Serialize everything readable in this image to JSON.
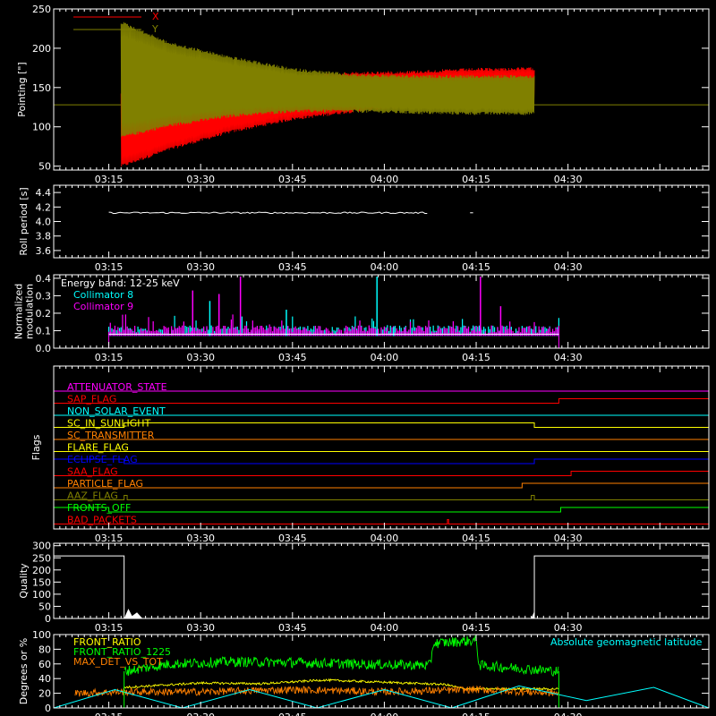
{
  "time_axis": {
    "start_minutes": 186,
    "end_minutes": 293,
    "ticks": [
      "03:15",
      "03:30",
      "03:45",
      "04:00",
      "04:15",
      "04:30"
    ],
    "tick_minutes": [
      195,
      210,
      225,
      240,
      255,
      270
    ]
  },
  "colors": {
    "background": "#000000",
    "axes": "#ffffff",
    "red": "#ff0000",
    "olive": "#808000",
    "white": "#ffffff",
    "cyan": "#00ffff",
    "magenta": "#ff00ff",
    "yellow": "#ffff00",
    "green": "#00ff00",
    "orange": "#ff8000",
    "blue": "#0000ff",
    "darkred": "#c00000"
  },
  "chart_data": [
    {
      "id": "pointing",
      "type": "area",
      "ylabel": "Pointing [\"]",
      "ylim": [
        45,
        250
      ],
      "yticks": [
        50,
        100,
        150,
        200,
        250
      ],
      "legend": [
        "X",
        "Y"
      ],
      "baseline_value": 128,
      "series": [
        {
          "name": "X",
          "color": "red",
          "envelope_time": [
            197,
            205,
            215,
            225,
            235,
            245,
            255,
            264.5
          ],
          "upper": [
            145,
            142,
            158,
            166,
            170,
            172,
            175,
            176
          ],
          "lower": [
            48,
            70,
            92,
            108,
            118,
            125,
            128,
            128
          ]
        },
        {
          "name": "Y",
          "color": "olive",
          "envelope_time": [
            197,
            205,
            215,
            225,
            235,
            245,
            255,
            264.5
          ],
          "upper": [
            235,
            208,
            190,
            175,
            168,
            166,
            166,
            166
          ],
          "lower": [
            85,
            100,
            112,
            118,
            118,
            116,
            115,
            115
          ]
        }
      ]
    },
    {
      "id": "roll",
      "type": "line",
      "ylabel": "Roll period [s]",
      "ylim": [
        3.5,
        4.5
      ],
      "yticks": [
        "3.6",
        "3.8",
        "4.0",
        "4.2",
        "4.4"
      ],
      "value": 4.12,
      "x_range": [
        195,
        247
      ]
    },
    {
      "id": "modulation",
      "type": "bar",
      "ylabel_lines": [
        "Normalized",
        "modulation"
      ],
      "ylim": [
        0,
        0.42
      ],
      "yticks": [
        "0.0",
        "0.1",
        "0.2",
        "0.3",
        "0.4"
      ],
      "legend_title": "Energy band: 12-25 keV",
      "series": [
        {
          "name": "Collimator 8",
          "color": "cyan"
        },
        {
          "name": "Collimator 9",
          "color": "magenta"
        }
      ],
      "x_range": [
        195,
        268.5
      ],
      "base_level": 0.08,
      "spikes": [
        {
          "x": 208.7,
          "v": 0.33
        },
        {
          "x": 211.5,
          "v": 0.27
        },
        {
          "x": 216.5,
          "v": 0.41
        },
        {
          "x": 238.8,
          "v": 0.41
        },
        {
          "x": 255.7,
          "v": 0.41
        },
        {
          "x": 241.5,
          "v": 0.12
        },
        {
          "x": 213.0,
          "v": 0.31
        },
        {
          "x": 224.0,
          "v": 0.22
        },
        {
          "x": 259.0,
          "v": 0.24
        }
      ]
    },
    {
      "id": "flags",
      "type": "table",
      "ylabel": "Flags",
      "flags": [
        {
          "name": "ATTENUATOR_STATE",
          "color": "magenta",
          "steps": [
            [
              186,
              0
            ]
          ]
        },
        {
          "name": "SAP_FLAG",
          "color": "red",
          "steps": [
            [
              186,
              0
            ],
            [
              268.5,
              1
            ]
          ]
        },
        {
          "name": "NON_SOLAR_EVENT",
          "color": "cyan",
          "steps": [
            [
              186,
              0
            ]
          ]
        },
        {
          "name": "SC_IN_SUNLIGHT",
          "color": "yellow",
          "steps": [
            [
              186,
              0
            ],
            [
              197.5,
              1
            ],
            [
              264.5,
              0
            ]
          ]
        },
        {
          "name": "SC_TRANSMITTER",
          "color": "orange",
          "steps": [
            [
              186,
              0
            ]
          ]
        },
        {
          "name": "FLARE_FLAG",
          "color": "yellow",
          "steps": [
            [
              186,
              0
            ]
          ]
        },
        {
          "name": "ECLIPSE_FLAG",
          "color": "blue",
          "steps": [
            [
              186,
              1
            ],
            [
              197.5,
              0
            ],
            [
              264.5,
              1
            ]
          ]
        },
        {
          "name": "SAA_FLAG",
          "color": "red",
          "steps": [
            [
              186,
              0
            ],
            [
              270.5,
              1
            ]
          ]
        },
        {
          "name": "PARTICLE_FLAG",
          "color": "orange",
          "steps": [
            [
              186,
              0
            ],
            [
              262.5,
              1
            ]
          ]
        },
        {
          "name": "AAZ_FLAG",
          "color": "olive",
          "steps": [
            [
              186,
              0
            ],
            [
              197.5,
              1
            ],
            [
              198,
              0
            ],
            [
              264,
              1
            ],
            [
              264.5,
              0
            ]
          ]
        },
        {
          "name": "FRONTS_OFF",
          "color": "green",
          "steps": [
            [
              186,
              1
            ],
            [
              195,
              0
            ],
            [
              268.8,
              1
            ]
          ]
        },
        {
          "name": "BAD_PACKETS",
          "color": "red",
          "steps": [
            [
              186,
              0
            ],
            [
              250.3,
              1
            ],
            [
              250.5,
              0
            ]
          ]
        }
      ]
    },
    {
      "id": "quality",
      "type": "line",
      "ylabel": "Quality",
      "ylim": [
        0,
        310
      ],
      "yticks": [
        "0",
        "50",
        "100",
        "150",
        "200",
        "250",
        "300"
      ],
      "points": [
        [
          186,
          258
        ],
        [
          197.5,
          258
        ],
        [
          197.5,
          0
        ],
        [
          264.5,
          0
        ],
        [
          264.5,
          258
        ],
        [
          293,
          258
        ]
      ]
    },
    {
      "id": "ratios",
      "type": "line",
      "ylabel": "Degrees or %",
      "ylim": [
        0,
        100
      ],
      "yticks": [
        "0",
        "20",
        "40",
        "60",
        "80",
        "100"
      ],
      "legend_right": "Absolute geomagnetic latitude",
      "series": [
        {
          "name": "FRONT_RATIO",
          "color": "yellow",
          "points": [
            [
              197.5,
              28
            ],
            [
              210,
              34
            ],
            [
              220,
              33
            ],
            [
              230,
              38
            ],
            [
              240,
              35
            ],
            [
              250,
              32
            ],
            [
              253,
              26
            ],
            [
              264.5,
              26
            ],
            [
              268.5,
              26
            ]
          ]
        },
        {
          "name": "FRONT_RATIO_1225",
          "color": "green",
          "points": [
            [
              197.5,
              50
            ],
            [
              205,
              60
            ],
            [
              215,
              63
            ],
            [
              225,
              62
            ],
            [
              235,
              60
            ],
            [
              247.5,
              58
            ],
            [
              248,
              88
            ],
            [
              255,
              92
            ],
            [
              255.5,
              58
            ],
            [
              268.5,
              50
            ]
          ]
        },
        {
          "name": "MAX_DET_VS_TOT",
          "color": "orange",
          "points": [
            [
              189.5,
              20
            ],
            [
              197.5,
              22
            ],
            [
              210,
              22
            ],
            [
              225,
              25
            ],
            [
              240,
              22
            ],
            [
              255,
              25
            ],
            [
              268.5,
              20
            ]
          ]
        },
        {
          "name": "Absolute geomagnetic latitude",
          "color": "cyan",
          "points": [
            [
              186,
              0
            ],
            [
              196,
              25
            ],
            [
              207,
              0
            ],
            [
              218,
              25
            ],
            [
              229,
              0
            ],
            [
              240,
              25
            ],
            [
              251,
              0
            ],
            [
              262,
              30
            ],
            [
              273,
              10
            ],
            [
              284,
              28
            ],
            [
              293,
              0
            ]
          ]
        }
      ]
    }
  ]
}
